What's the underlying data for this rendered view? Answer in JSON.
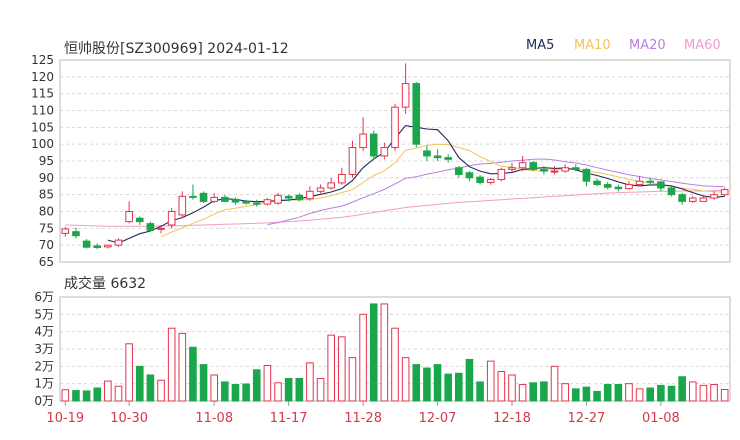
{
  "header": {
    "title": "恒帅股份[SZ300969] 2024-01-12"
  },
  "legend": [
    {
      "label": "MA5",
      "color": "#1f2a5a"
    },
    {
      "label": "MA10",
      "color": "#f5c35a"
    },
    {
      "label": "MA20",
      "color": "#b97fe0"
    },
    {
      "label": "MA60",
      "color": "#f49ac7"
    }
  ],
  "volume_panel": {
    "label": "成交量 6632"
  },
  "colors": {
    "up": "#e6334d",
    "down": "#1aa64a",
    "grid": "#d8d8d8",
    "axis_text": "#333333",
    "date_text": "#d33a4a"
  },
  "chart_data": [
    {
      "type": "candlestick",
      "title": "恒帅股份[SZ300969] 2024-01-12",
      "ylim": [
        65,
        125
      ],
      "yticks": [
        65,
        70,
        75,
        80,
        85,
        90,
        95,
        100,
        105,
        110,
        115,
        120,
        125
      ],
      "xticks": [
        "10-19",
        "10-30",
        "11-08",
        "11-17",
        "11-28",
        "12-07",
        "12-18",
        "12-27",
        "01-08"
      ],
      "xtick_index": [
        0,
        6,
        14,
        21,
        28,
        35,
        42,
        49,
        56
      ],
      "open": [
        73.5,
        74.0,
        71.2,
        69.8,
        69.5,
        70.0,
        77.0,
        78.0,
        76.4,
        74.8,
        76.0,
        79.0,
        84.5,
        85.4,
        83.0,
        84.2,
        83.6,
        83.0,
        82.5,
        82.2,
        82.5,
        84.5,
        84.8,
        83.8,
        86.0,
        87.0,
        88.5,
        91.0,
        99.0,
        103.0,
        96.5,
        99.0,
        111.0,
        118.0,
        98.0,
        96.5,
        96.0,
        93.0,
        91.5,
        90.2,
        88.6,
        89.5,
        92.5,
        93.0,
        94.5,
        92.5,
        92.0,
        92.0,
        93.0,
        92.5,
        89.0,
        88.0,
        87.2,
        86.8,
        88.0,
        89.0,
        88.8,
        87.0,
        85.0,
        83.0,
        83.0,
        84.0,
        85.0
      ],
      "close": [
        74.8,
        72.8,
        69.4,
        69.3,
        70.0,
        71.5,
        80.0,
        77.0,
        74.4,
        75.0,
        80.0,
        84.5,
        84.2,
        83.0,
        84.2,
        83.0,
        82.8,
        82.5,
        82.2,
        83.5,
        84.8,
        84.0,
        83.5,
        86.0,
        87.0,
        88.5,
        91.0,
        99.0,
        103.0,
        96.5,
        99.0,
        111.0,
        118.0,
        100.0,
        96.5,
        96.0,
        95.5,
        91.0,
        90.0,
        88.6,
        89.5,
        92.5,
        93.0,
        94.5,
        92.5,
        92.0,
        92.0,
        93.0,
        92.5,
        89.0,
        88.0,
        87.2,
        86.8,
        88.0,
        89.0,
        88.8,
        87.0,
        85.0,
        83.0,
        84.0,
        84.0,
        85.0,
        86.5
      ],
      "high": [
        75.5,
        75.2,
        71.8,
        70.5,
        70.2,
        72.0,
        83.0,
        78.5,
        77.0,
        76.0,
        81.0,
        86.0,
        88.0,
        86.0,
        85.5,
        85.0,
        84.2,
        83.5,
        83.5,
        84.0,
        85.5,
        85.0,
        85.5,
        87.5,
        88.0,
        90.0,
        93.0,
        101.0,
        108.0,
        104.0,
        100.5,
        112.0,
        124.0,
        118.5,
        99.5,
        98.5,
        97.0,
        93.5,
        92.0,
        90.8,
        90.0,
        93.0,
        94.5,
        96.5,
        95.0,
        93.5,
        93.5,
        94.0,
        94.0,
        93.0,
        89.8,
        88.8,
        88.0,
        89.0,
        90.5,
        90.0,
        89.0,
        87.5,
        85.5,
        84.5,
        84.5,
        86.0,
        87.0
      ],
      "low": [
        72.5,
        72.0,
        69.0,
        68.8,
        69.0,
        69.5,
        76.5,
        76.0,
        74.0,
        73.5,
        75.0,
        78.0,
        83.5,
        82.5,
        82.5,
        82.8,
        82.0,
        82.0,
        81.5,
        81.8,
        82.0,
        83.0,
        83.0,
        83.2,
        85.5,
        86.5,
        88.0,
        90.0,
        98.0,
        95.5,
        95.5,
        98.0,
        109.0,
        99.0,
        95.0,
        95.0,
        94.5,
        90.0,
        89.0,
        88.0,
        88.0,
        89.0,
        91.5,
        92.0,
        92.0,
        91.0,
        91.0,
        91.5,
        92.0,
        87.5,
        87.5,
        86.5,
        86.0,
        86.5,
        87.5,
        88.0,
        86.0,
        84.5,
        82.0,
        82.5,
        83.0,
        83.5,
        84.5
      ],
      "series": [
        {
          "name": "MA5",
          "values": [
            null,
            null,
            null,
            null,
            71.5,
            70.6,
            72.0,
            73.4,
            74.2,
            75.6,
            77.3,
            78.2,
            79.6,
            81.3,
            83.2,
            83.8,
            83.6,
            83.1,
            82.9,
            83.0,
            83.2,
            83.4,
            83.8,
            84.4,
            85.1,
            85.8,
            86.8,
            89.2,
            93.0,
            95.6,
            97.6,
            101.7,
            105.5,
            105.0,
            104.5,
            104.3,
            101.0,
            96.0,
            93.3,
            92.0,
            91.2,
            91.3,
            91.6,
            92.5,
            92.8,
            93.0,
            92.8,
            92.9,
            92.4,
            91.4,
            90.7,
            89.8,
            88.8,
            87.9,
            87.6,
            87.9,
            87.9,
            87.6,
            86.7,
            85.6,
            84.6,
            84.2,
            84.5
          ]
        },
        {
          "name": "MA10",
          "values": [
            null,
            null,
            null,
            null,
            null,
            null,
            null,
            null,
            null,
            72.5,
            73.9,
            75.1,
            76.5,
            77.7,
            79.2,
            80.5,
            81.0,
            81.5,
            82.0,
            83.0,
            83.4,
            83.5,
            83.4,
            83.6,
            84.0,
            84.7,
            85.6,
            86.5,
            88.6,
            90.7,
            92.1,
            94.5,
            98.2,
            98.8,
            99.7,
            100.0,
            99.9,
            99.0,
            98.1,
            96.3,
            94.9,
            93.4,
            93.2,
            92.5,
            92.1,
            92.2,
            92.4,
            92.5,
            92.8,
            92.0,
            91.6,
            91.0,
            90.3,
            89.5,
            89.0,
            88.5,
            88.1,
            87.6,
            86.9,
            86.6,
            86.1,
            85.9,
            85.7
          ]
        },
        {
          "name": "MA20",
          "values": [
            null,
            null,
            null,
            null,
            null,
            null,
            null,
            null,
            null,
            null,
            null,
            null,
            null,
            null,
            null,
            null,
            null,
            null,
            null,
            76.1,
            76.7,
            77.5,
            78.3,
            79.4,
            80.3,
            81.0,
            81.6,
            82.8,
            84.1,
            85.3,
            86.6,
            88.2,
            89.9,
            90.3,
            91.1,
            91.7,
            92.4,
            92.9,
            93.6,
            94.1,
            94.3,
            94.6,
            95.0,
            95.2,
            95.5,
            95.6,
            95.3,
            94.8,
            94.4,
            93.8,
            93.0,
            92.3,
            91.6,
            90.9,
            90.4,
            89.8,
            89.4,
            88.9,
            88.4,
            88.0,
            87.6,
            87.5,
            87.3
          ]
        },
        {
          "name": "MA60",
          "values": [
            76.0,
            75.9,
            75.8,
            75.7,
            75.6,
            75.6,
            75.6,
            75.6,
            75.6,
            75.7,
            75.7,
            75.8,
            75.9,
            76.0,
            76.1,
            76.2,
            76.3,
            76.4,
            76.5,
            76.6,
            76.8,
            77.0,
            77.2,
            77.4,
            77.7,
            78.0,
            78.3,
            78.7,
            79.2,
            79.7,
            80.2,
            80.7,
            81.2,
            81.5,
            81.8,
            82.1,
            82.4,
            82.7,
            82.9,
            83.1,
            83.3,
            83.5,
            83.7,
            83.9,
            84.1,
            84.3,
            84.5,
            84.7,
            84.9,
            85.1,
            85.3,
            85.5,
            85.6,
            85.7,
            85.8,
            85.9,
            86.0,
            86.0,
            86.1,
            86.1,
            86.1,
            86.2,
            86.2
          ]
        }
      ]
    },
    {
      "type": "bar",
      "title": "成交量 6632",
      "ylim": [
        0,
        60000
      ],
      "yticks": [
        "0万",
        "1万",
        "2万",
        "3万",
        "4万",
        "5万",
        "6万"
      ],
      "xticks": [
        "10-19",
        "10-30",
        "11-08",
        "11-17",
        "11-28",
        "12-07",
        "12-18",
        "12-27",
        "01-08"
      ],
      "values": [
        6500,
        6000,
        5800,
        7500,
        11500,
        8500,
        33000,
        20000,
        15000,
        12000,
        42000,
        39000,
        31000,
        21000,
        15000,
        11000,
        9500,
        9800,
        18000,
        20500,
        10500,
        13000,
        13000,
        22000,
        13000,
        38000,
        37000,
        25000,
        50000,
        56000,
        56000,
        42000,
        25000,
        21000,
        19000,
        21000,
        15500,
        16000,
        24000,
        11000,
        23000,
        17000,
        15000,
        9500,
        10500,
        11000,
        20000,
        10000,
        7000,
        8000,
        5500,
        9500,
        9500,
        10000,
        7000,
        7500,
        9000,
        8500,
        14000,
        11000,
        9000,
        9500,
        6632
      ]
    }
  ]
}
